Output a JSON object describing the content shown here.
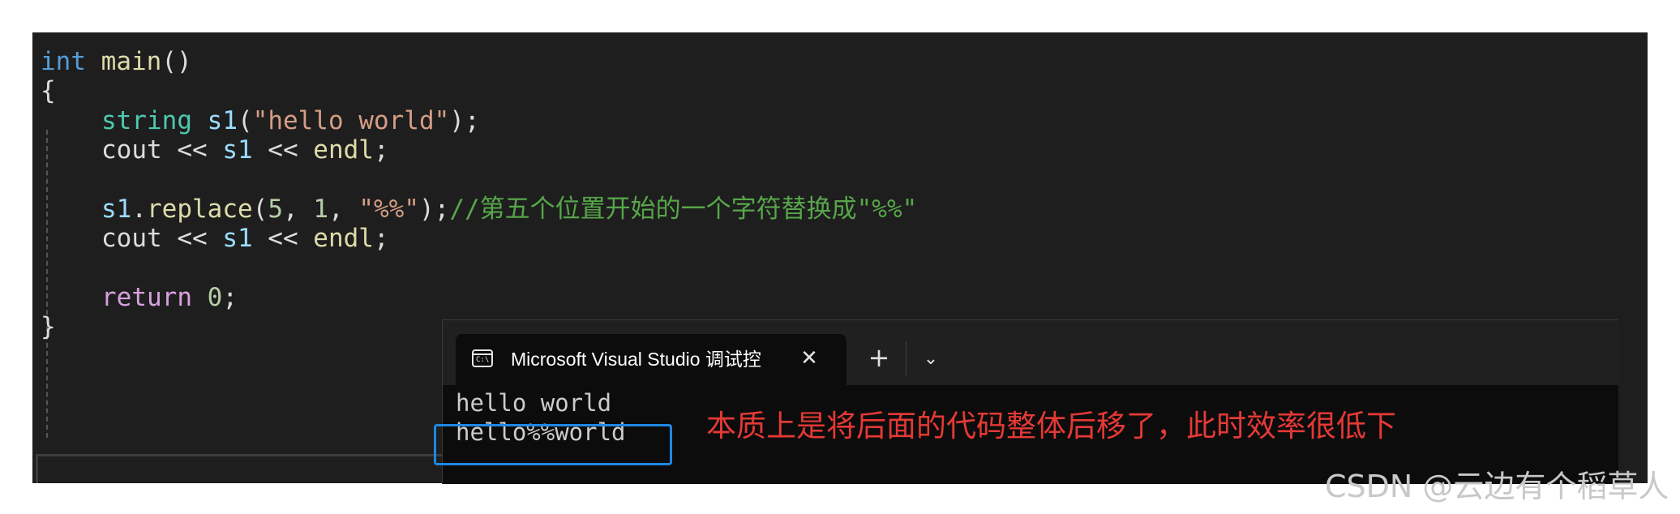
{
  "editor": {
    "lines": {
      "l1": {
        "kw": "int",
        "fn": "main",
        "rest": "()"
      },
      "l2": {
        "text": "{"
      },
      "l3": {
        "type": "string",
        "var": "s1",
        "open": "(",
        "str": "\"hello world\"",
        "close": ");"
      },
      "l4": {
        "a": "cout << ",
        "var": "s1",
        "b": " << ",
        "fn": "endl",
        "c": ";"
      },
      "l6": {
        "var": "s1",
        "dot": ".",
        "fn": "replace",
        "open": "(",
        "n1": "5",
        "sep1": ", ",
        "n2": "1",
        "sep2": ", ",
        "str": "\"%%\"",
        "close": ");",
        "comment": "//第五个位置开始的一个字符替换成\"%%\""
      },
      "l7": {
        "a": "cout << ",
        "var": "s1",
        "b": " << ",
        "fn": "endl",
        "c": ";"
      },
      "l9": {
        "kw": "return",
        "sp": " ",
        "num": "0",
        "c": ";"
      },
      "l10": {
        "text": "}"
      }
    }
  },
  "terminal": {
    "tab_icon_text": "C:\\",
    "tab_title": "Microsoft Visual Studio 调试控",
    "close_glyph": "✕",
    "new_tab_glyph": "+",
    "dropdown_glyph": "⌄",
    "output": [
      "hello world",
      "hello%%world"
    ]
  },
  "annotation": "本质上是将后面的代码整体后移了，此时效率很低下",
  "watermark": "CSDN @云边有个稻草人",
  "colors": {
    "editor_bg": "#1e1e1e",
    "terminal_bg": "#0c0c0c",
    "highlight_box": "#1e88e5",
    "annotation": "#e53935"
  }
}
